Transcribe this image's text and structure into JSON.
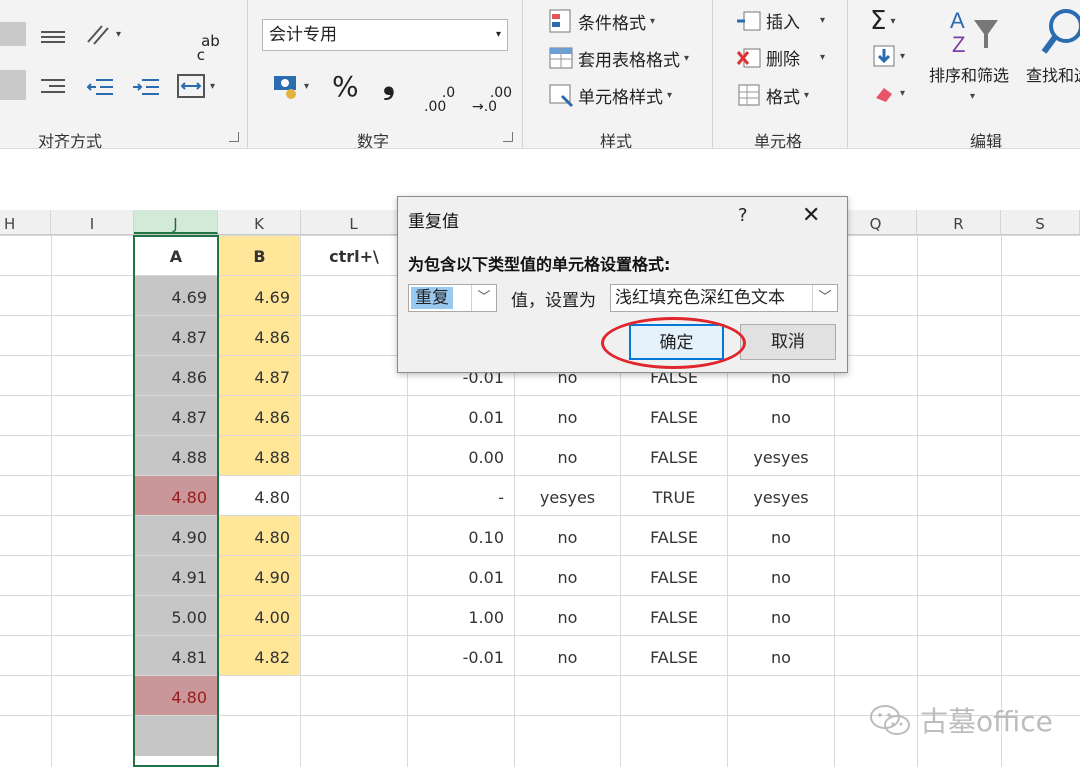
{
  "ribbon": {
    "groups": {
      "alignment": "对齐方式",
      "number": "数字",
      "styles": "样式",
      "cells": "单元格",
      "editing": "编辑"
    },
    "wrap_glyph": "ab\nc",
    "number_format_value": "会计专用",
    "percent_glyph": "%",
    "comma_glyph": "❟",
    "inc_decimal": ".0\n.00",
    "dec_decimal": ".00\n→.0",
    "conditional_format": "条件格式",
    "table_format": "套用表格格式",
    "cell_styles": "单元格样式",
    "insert": "插入",
    "delete": "删除",
    "format": "格式",
    "sort_filter": "排序和筛选",
    "find_select": "查找和选"
  },
  "columns": [
    "H",
    "I",
    "J",
    "K",
    "L",
    "Q",
    "R",
    "S"
  ],
  "grid": {
    "headers": {
      "j": "A",
      "k": "B",
      "l": "ctrl+\\"
    },
    "rows": [
      {
        "j": "4.69",
        "k": "4.69",
        "n": "",
        "o": "",
        "p": "",
        "q": ""
      },
      {
        "j": "4.87",
        "k": "4.86",
        "n": "",
        "o": "",
        "p": "",
        "q": ""
      },
      {
        "j": "4.86",
        "k": "4.87",
        "n": "-0.01",
        "o": "no",
        "p": "FALSE",
        "q": "no"
      },
      {
        "j": "4.87",
        "k": "4.86",
        "n": "0.01",
        "o": "no",
        "p": "FALSE",
        "q": "no"
      },
      {
        "j": "4.88",
        "k": "4.88",
        "n": "0.00",
        "o": "no",
        "p": "FALSE",
        "q": "yesyes"
      },
      {
        "j": "4.80",
        "k": "4.80",
        "n": "-",
        "o": "yesyes",
        "p": "TRUE",
        "q": "yesyes"
      },
      {
        "j": "4.90",
        "k": "4.80",
        "n": "0.10",
        "o": "no",
        "p": "FALSE",
        "q": "no"
      },
      {
        "j": "4.91",
        "k": "4.90",
        "n": "0.01",
        "o": "no",
        "p": "FALSE",
        "q": "no"
      },
      {
        "j": "5.00",
        "k": "4.00",
        "n": "1.00",
        "o": "no",
        "p": "FALSE",
        "q": "no"
      },
      {
        "j": "4.81",
        "k": "4.82",
        "n": "-0.01",
        "o": "no",
        "p": "FALSE",
        "q": "no"
      },
      {
        "j": "4.80",
        "k": "",
        "n": "",
        "o": "",
        "p": "",
        "q": ""
      },
      {
        "j": "",
        "k": "",
        "n": "",
        "o": "",
        "p": "",
        "q": ""
      }
    ],
    "colors": {
      "gray_fill": "#c6c6c6",
      "duplicate_fill": "#c9969a",
      "duplicate_text": "#9c1c1c",
      "yellow_fill": "#ffe699"
    }
  },
  "dialog": {
    "title": "重复值",
    "help": "?",
    "close": "✕",
    "prompt": "为包含以下类型值的单元格设置格式:",
    "type_value": "重复",
    "value_label": "值，设置为",
    "format_value": "浅红填充色深红色文本",
    "ok_label": "确定",
    "cancel_label": "取消",
    "highlight_color": "#e0262d"
  },
  "watermark": {
    "icon": "wechat-icon",
    "text": "古墓office"
  }
}
